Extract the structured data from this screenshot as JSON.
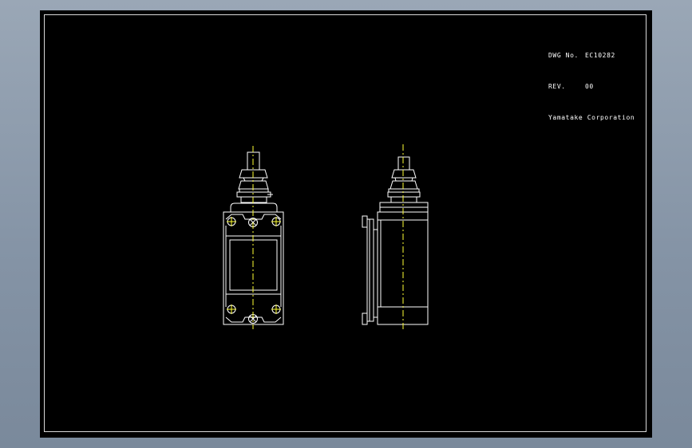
{
  "title_block": {
    "dwg_label": "DWG No.",
    "dwg_value": "EC10282",
    "rev_label": "REV.",
    "rev_value": "00",
    "company": "Yamatake Corporation"
  },
  "colors": {
    "background": "#000000",
    "outline": "#ffffff",
    "centerline": "#ffff33",
    "frame": "#d8d8d8"
  },
  "views": [
    "front-view",
    "side-view"
  ]
}
